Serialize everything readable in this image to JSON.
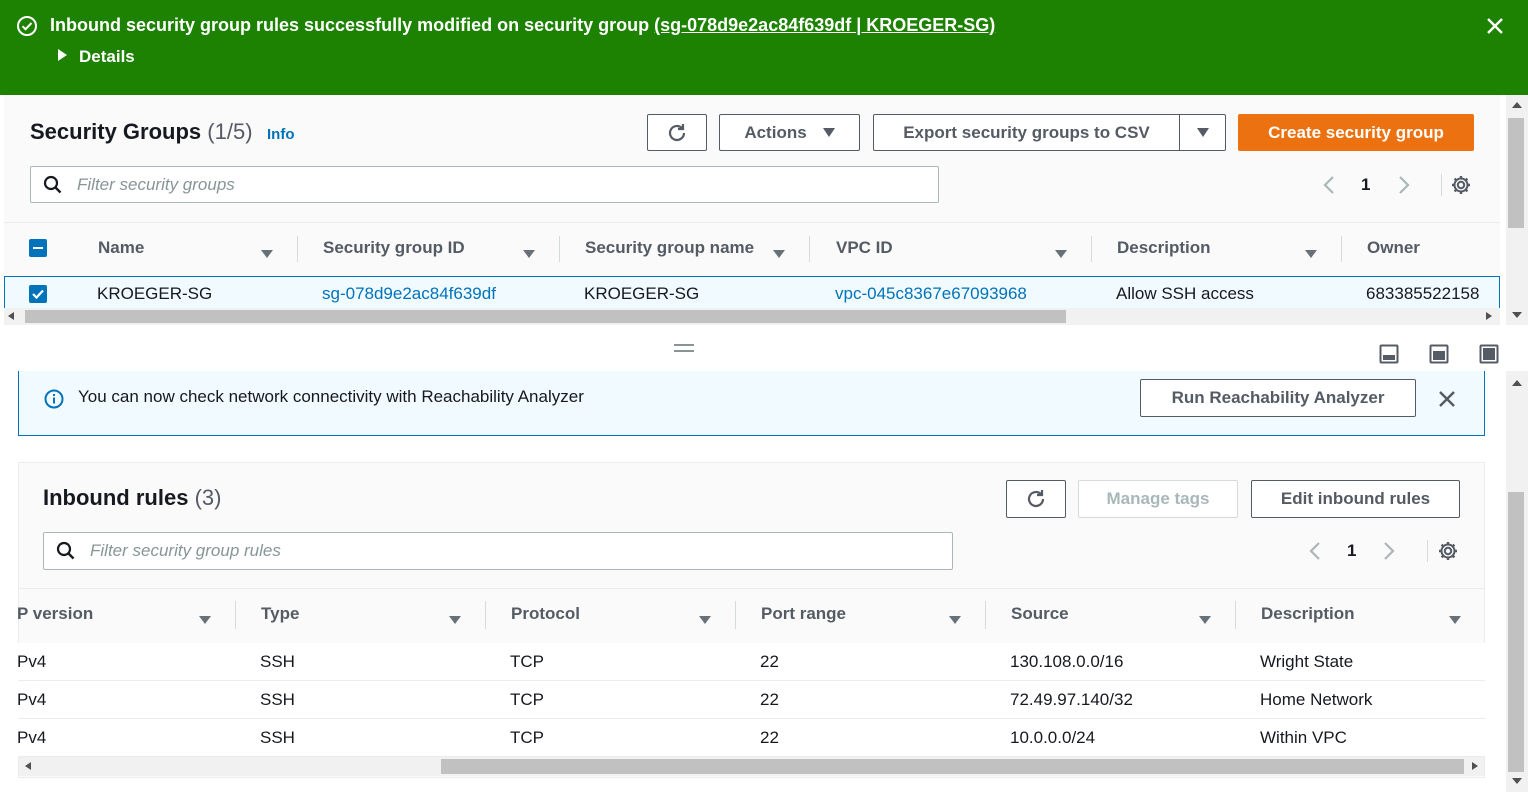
{
  "flash": {
    "message": "Inbound security group rules successfully modified on security group",
    "link": "(sg-078d9e2ac84f639df | KROEGER-SG)",
    "details_label": "Details",
    "color": "#1d8102"
  },
  "security_groups": {
    "title": "Security Groups",
    "count": "(1/5)",
    "info_label": "Info",
    "actions_label": "Actions",
    "export_label": "Export security groups to CSV",
    "create_label": "Create security group",
    "filter_placeholder": "Filter security groups",
    "page": "1",
    "columns": [
      "Name",
      "Security group ID",
      "Security group name",
      "VPC ID",
      "Description",
      "Owner"
    ],
    "row": {
      "name": "KROEGER-SG",
      "id": "sg-078d9e2ac84f639df",
      "group_name": "KROEGER-SG",
      "vpc_id": "vpc-045c8367e67093968",
      "description": "Allow SSH access",
      "owner": "683385522158"
    }
  },
  "alert": {
    "text": "You can now check network connectivity with Reachability Analyzer",
    "button_label": "Run Reachability Analyzer"
  },
  "inbound": {
    "title": "Inbound rules",
    "count": "(3)",
    "manage_tags_label": "Manage tags",
    "edit_label": "Edit inbound rules",
    "filter_placeholder": "Filter security group rules",
    "page": "1",
    "columns": [
      "P version",
      "Type",
      "Protocol",
      "Port range",
      "Source",
      "Description"
    ],
    "rows": [
      {
        "ip_version": "Pv4",
        "type": "SSH",
        "protocol": "TCP",
        "port_range": "22",
        "source": "130.108.0.0/16",
        "description": "Wright State"
      },
      {
        "ip_version": "Pv4",
        "type": "SSH",
        "protocol": "TCP",
        "port_range": "22",
        "source": "72.49.97.140/32",
        "description": "Home Network"
      },
      {
        "ip_version": "Pv4",
        "type": "SSH",
        "protocol": "TCP",
        "port_range": "22",
        "source": "10.0.0.0/24",
        "description": "Within VPC"
      }
    ]
  },
  "colors": {
    "primary": "#ec7211",
    "link": "#0073bb",
    "selected_border": "#0073bb"
  }
}
